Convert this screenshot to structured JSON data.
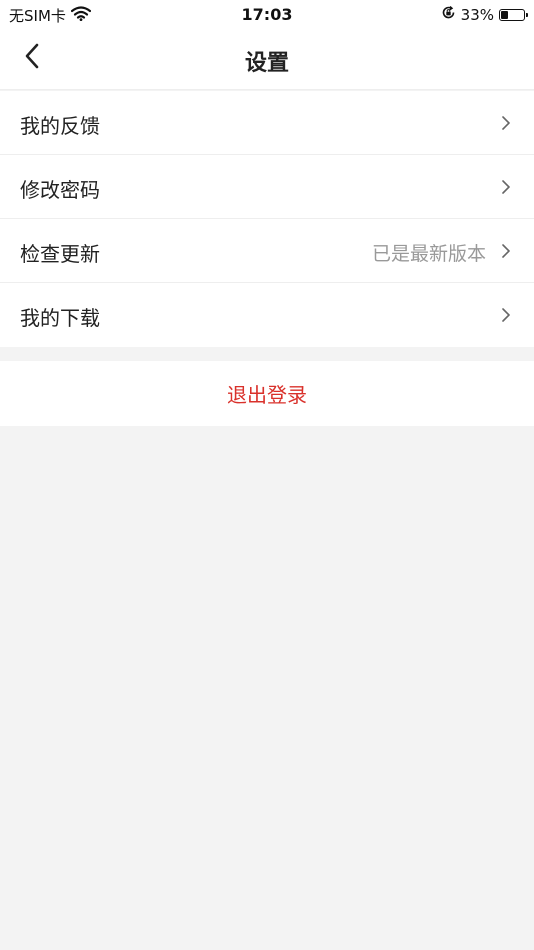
{
  "status_bar": {
    "carrier": "无SIM卡",
    "time": "17:03",
    "battery_percent": "33%",
    "battery_level": 0.33,
    "icons": [
      "wifi-icon",
      "orientation-lock-icon",
      "battery-icon"
    ]
  },
  "nav": {
    "title": "设置",
    "back_icon": "chevron-left-icon"
  },
  "settings": {
    "items": [
      {
        "label": "我的反馈",
        "value": ""
      },
      {
        "label": "修改密码",
        "value": ""
      },
      {
        "label": "检查更新",
        "value": "已是最新版本"
      },
      {
        "label": "我的下载",
        "value": ""
      }
    ]
  },
  "logout": {
    "label": "退出登录"
  },
  "colors": {
    "background": "#f3f3f3",
    "surface": "#ffffff",
    "divider": "#eeeeee",
    "logout_red": "#d9312b",
    "secondary_text": "#999999"
  }
}
